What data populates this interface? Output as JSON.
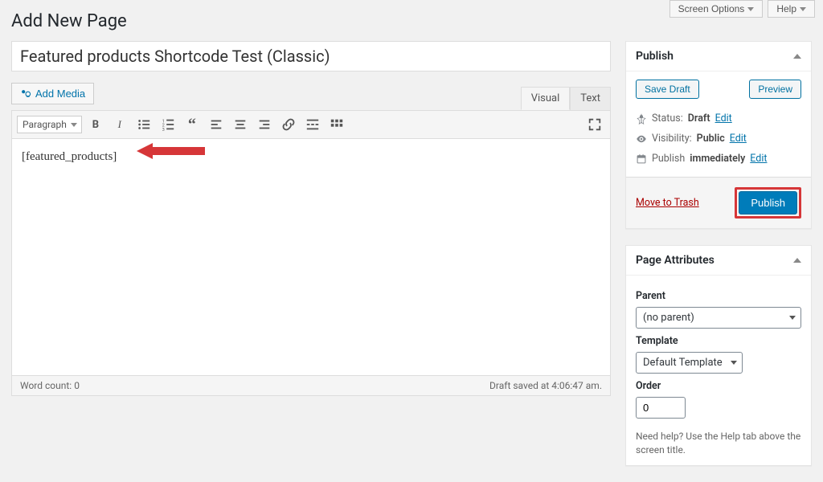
{
  "topbar": {
    "screen_options": "Screen Options",
    "help": "Help"
  },
  "heading": "Add New Page",
  "title_value": "Featured products Shortcode Test (Classic)",
  "add_media": "Add Media",
  "editor": {
    "tabs": {
      "visual": "Visual",
      "text": "Text"
    },
    "format": "Paragraph",
    "content": "[featured_products]",
    "word_count_label": "Word count:",
    "word_count": "0",
    "draft_saved": "Draft saved at 4:06:47 am."
  },
  "publish_box": {
    "title": "Publish",
    "save_draft": "Save Draft",
    "preview": "Preview",
    "status_label": "Status:",
    "status_value": "Draft",
    "visibility_label": "Visibility:",
    "visibility_value": "Public",
    "schedule_label": "Publish",
    "schedule_value": "immediately",
    "edit": "Edit",
    "trash": "Move to Trash",
    "publish": "Publish"
  },
  "attributes_box": {
    "title": "Page Attributes",
    "parent_label": "Parent",
    "parent_value": "(no parent)",
    "template_label": "Template",
    "template_value": "Default Template",
    "order_label": "Order",
    "order_value": "0",
    "help_text": "Need help? Use the Help tab above the screen title."
  }
}
